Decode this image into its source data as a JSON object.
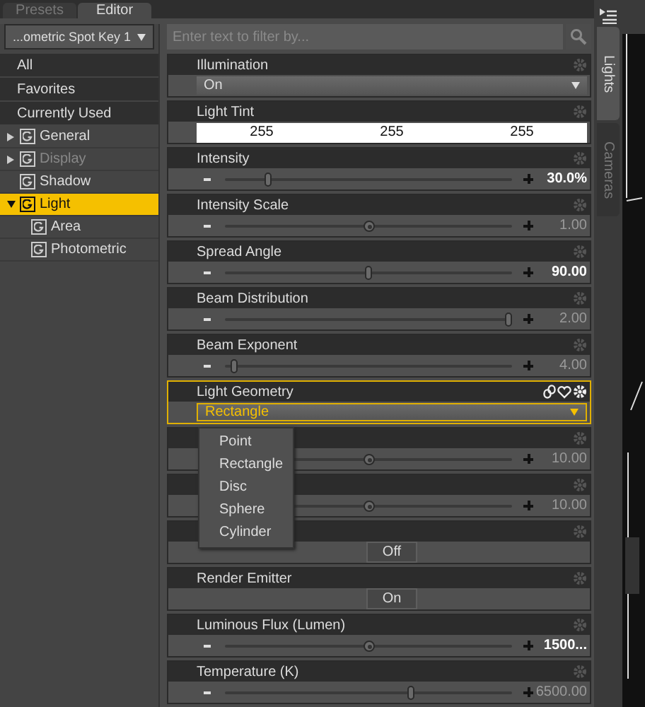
{
  "tabs": [
    {
      "label": "Presets",
      "selected": false
    },
    {
      "label": "Editor",
      "selected": true
    }
  ],
  "preset_dropdown": {
    "value": "...ometric Spot Key 1"
  },
  "filters": [
    {
      "label": "All"
    },
    {
      "label": "Favorites"
    },
    {
      "label": "Currently Used"
    }
  ],
  "groups": [
    {
      "label": "General",
      "expanded": false,
      "selected": false,
      "disabled": false
    },
    {
      "label": "Display",
      "expanded": false,
      "selected": false,
      "disabled": true
    },
    {
      "label": "Shadow",
      "selected": false,
      "disabled": false
    },
    {
      "label": "Light",
      "expanded": true,
      "selected": true,
      "disabled": false,
      "children": [
        {
          "label": "Area",
          "selected": false,
          "disabled": false
        },
        {
          "label": "Photometric",
          "selected": false,
          "disabled": false
        }
      ]
    }
  ],
  "search": {
    "placeholder": "Enter text to filter by..."
  },
  "properties": [
    {
      "kind": "dropdown",
      "label": "Illumination",
      "value": "On",
      "highlighted": false
    },
    {
      "kind": "color",
      "label": "Light Tint",
      "values": [
        "255",
        "255",
        "255"
      ]
    },
    {
      "kind": "slider",
      "label": "Intensity",
      "level": 0.14,
      "round_thumb": false,
      "modified": true,
      "value": "30.0%"
    },
    {
      "kind": "slider",
      "label": "Intensity Scale",
      "level": 0.5,
      "round_thumb": true,
      "modified": false,
      "value": "1.00"
    },
    {
      "kind": "slider",
      "label": "Spread Angle",
      "level": 0.5,
      "round_thumb": false,
      "modified": true,
      "value": "90.00"
    },
    {
      "kind": "slider",
      "label": "Beam Distribution",
      "level": 1.0,
      "round_thumb": false,
      "modified": false,
      "value": "2.00"
    },
    {
      "kind": "slider",
      "label": "Beam Exponent",
      "level": 0.02,
      "round_thumb": false,
      "modified": false,
      "value": "4.00"
    },
    {
      "kind": "dropdown",
      "label": "Light Geometry",
      "value": "Rectangle",
      "highlighted": true,
      "options": [
        {
          "label": "Point"
        },
        {
          "label": "Rectangle"
        },
        {
          "label": "Disc"
        },
        {
          "label": "Sphere"
        },
        {
          "label": "Cylinder"
        }
      ]
    },
    {
      "kind": "slider",
      "level": 0.5,
      "round_thumb": true,
      "modified": false,
      "value": "10.00"
    },
    {
      "kind": "slider",
      "level": 0.5,
      "round_thumb": true,
      "modified": false,
      "value": "10.00"
    },
    {
      "kind": "toggle",
      "value": "Off"
    },
    {
      "kind": "toggle",
      "label": "Render Emitter",
      "value": "On"
    },
    {
      "kind": "slider",
      "label": "Luminous Flux (Lumen)",
      "level": 0.5,
      "round_thumb": true,
      "modified": true,
      "value": "1500..."
    },
    {
      "kind": "slider",
      "label": "Temperature (K)",
      "level": 0.65,
      "round_thumb": false,
      "modified": false,
      "value": "6500.00"
    }
  ],
  "side_tabs": [
    {
      "label": "Lights",
      "selected": true
    },
    {
      "label": "Cameras",
      "selected": false
    }
  ]
}
